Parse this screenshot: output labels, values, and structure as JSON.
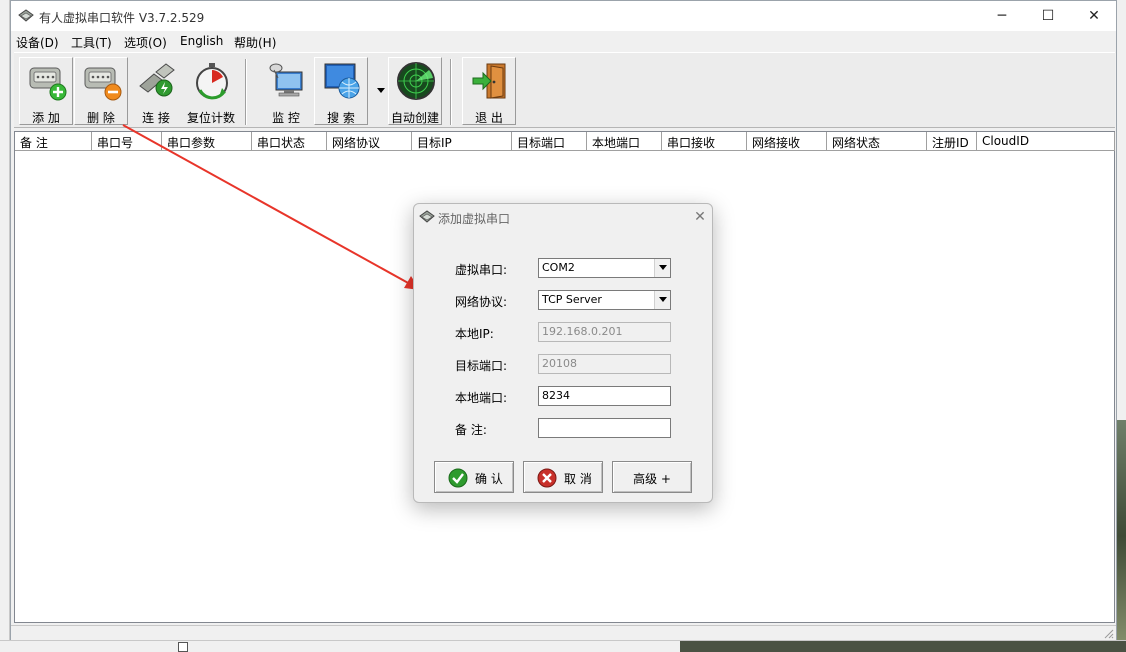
{
  "window": {
    "title": "有人虚拟串口软件 V3.7.2.529",
    "minimize": "─",
    "maximize": "☐",
    "close": "✕"
  },
  "menu": [
    "设备(D)",
    "工具(T)",
    "选项(O)",
    "English",
    "帮助(H)"
  ],
  "toolbar": {
    "add": "添 加",
    "delete": "删 除",
    "connect": "连 接",
    "reset_count": "复位计数",
    "monitor": "监 控",
    "search": "搜 索",
    "auto_create": "自动创建",
    "exit": "退 出"
  },
  "icons": {
    "add": "serial-port-add-icon",
    "delete": "serial-port-remove-icon",
    "connect": "connect-plug-icon",
    "reset": "reset-timer-icon",
    "monitor": "monitor-computer-icon",
    "search": "globe-search-icon",
    "auto_create": "radar-icon",
    "exit": "exit-door-icon"
  },
  "list": {
    "columns": [
      "备 注",
      "串口号",
      "串口参数",
      "串口状态",
      "网络协议",
      "目标IP",
      "目标端口",
      "本地端口",
      "串口接收",
      "网络接收",
      "网络状态",
      "注册ID",
      "CloudID"
    ]
  },
  "dialog": {
    "title": "添加虚拟串口",
    "close": "✕",
    "fields": {
      "virtual_port_label": "虚拟串口:",
      "virtual_port_value": "COM2",
      "protocol_label": "网络协议:",
      "protocol_value": "TCP Server",
      "local_ip_label": "本地IP:",
      "local_ip_value": "192.168.0.201",
      "target_port_label": "目标端口:",
      "target_port_value": "20108",
      "local_port_label": "本地端口:",
      "local_port_value": "8234",
      "remark_label": "备  注:",
      "remark_value": ""
    },
    "buttons": {
      "confirm": "确 认",
      "cancel": "取 消",
      "advanced": "高级 +"
    }
  },
  "colors": {
    "annotation_arrow": "#e8352a",
    "confirm_green": "#2e9b2e",
    "cancel_red": "#c8302a"
  }
}
